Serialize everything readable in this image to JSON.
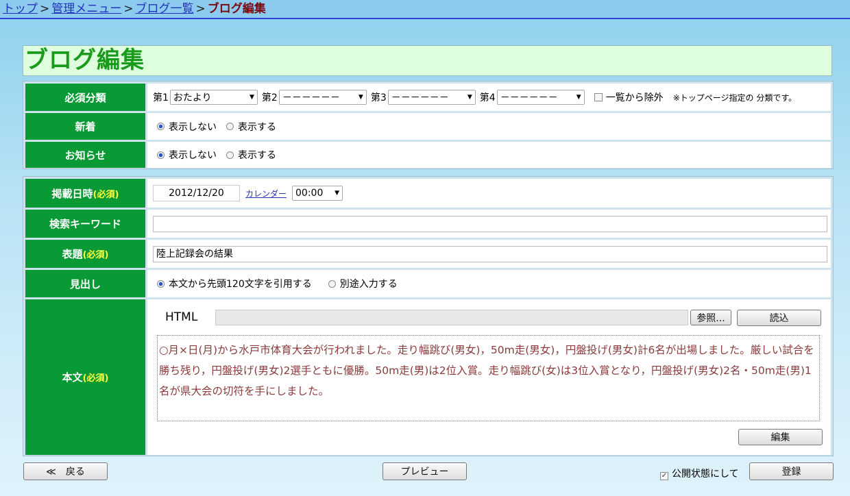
{
  "breadcrumb": {
    "items": [
      "トップ",
      "管理メニュー",
      "ブログ一覧"
    ],
    "separator": ">",
    "current": "ブログ編集"
  },
  "page_title": "ブログ編集",
  "category": {
    "label": "必須分類",
    "slots": [
      {
        "label": "第1",
        "value": "おたより"
      },
      {
        "label": "第2",
        "value": "－－－－－－"
      },
      {
        "label": "第3",
        "value": "－－－－－－"
      },
      {
        "label": "第4",
        "value": "－－－－－－"
      }
    ],
    "exclude_label": "一覧から除外",
    "exclude_checked": false,
    "note": "※トップページ指定の 分類です。"
  },
  "new_arrival": {
    "label": "新着",
    "options": [
      "表示しない",
      "表示する"
    ],
    "selected": "表示しない"
  },
  "notice": {
    "label": "お知らせ",
    "options": [
      "表示しない",
      "表示する"
    ],
    "selected": "表示しない"
  },
  "publish_date": {
    "label": "掲載日時",
    "required": "(必須)",
    "date": "2012/12/20",
    "calendar_link": "カレンダー",
    "time": "00:00"
  },
  "keywords": {
    "label": "検索キーワード",
    "value": ""
  },
  "subject": {
    "label": "表題",
    "required": "(必須)",
    "value": "陸上記録会の結果"
  },
  "heading": {
    "label": "見出し",
    "options": [
      "本文から先頭120文字を引用する",
      "別途入力する"
    ],
    "selected": "本文から先頭120文字を引用する"
  },
  "body": {
    "label": "本文",
    "required": "(必須)",
    "html_label": "HTML",
    "browse_button": "参照...",
    "load_button": "読込",
    "text": "○月×日(月)から水戸市体育大会が行われました。走り幅跳び(男女)，50m走(男女)，円盤投げ(男女)計6名が出場しました。厳しい試合を勝ち残り，円盤投げ(男女)2選手ともに優勝。50m走(男)は2位入賞。走り幅跳び(女)は3位入賞となり，円盤投げ(男女)2名・50m走(男)1名が県大会の切符を手にしました。",
    "edit_button": "編集"
  },
  "footer": {
    "back_button": "≪　戻る",
    "preview_button": "プレビュー",
    "public_label": "公開状態にして",
    "public_checked": true,
    "register_button": "登録"
  },
  "colors": {
    "label_bg": "#0a9a35",
    "title_text": "#1a9a1a",
    "title_bg": "#ddffdd",
    "required_text": "#ffff40"
  }
}
